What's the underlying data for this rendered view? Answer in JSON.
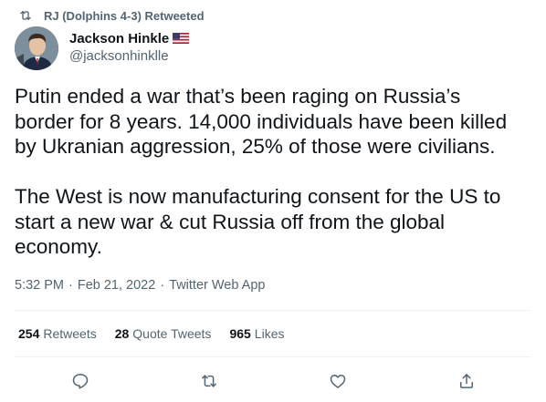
{
  "social_context": {
    "label": "RJ (Dolphins 4-3) Retweeted",
    "icon": "retweet-icon"
  },
  "author": {
    "display_name": "Jackson Hinkle",
    "handle": "@jacksonhinklle",
    "flag": "us-flag-icon"
  },
  "tweet": {
    "paragraphs": [
      "Putin ended a war that’s been raging on Russia’s\nborder for 8 years. 14,000 individuals have been killed\nby Ukranian aggression, 25% of those were civilians.",
      "The West is now manufacturing consent for the US to\nstart a new war & cut Russia off from the global\neconomy."
    ],
    "time": "5:32 PM",
    "date": "Feb 21, 2022",
    "separator": "·",
    "source": "Twitter Web App"
  },
  "stats": {
    "retweets": {
      "count": "254",
      "label": "Retweets"
    },
    "quotes": {
      "count": "28",
      "label": "Quote Tweets"
    },
    "likes": {
      "count": "965",
      "label": "Likes"
    }
  },
  "actions": [
    "reply-icon",
    "retweet-icon",
    "like-icon",
    "share-icon"
  ],
  "colors": {
    "text_primary": "#0f1419",
    "text_secondary": "#536471",
    "divider": "#eff3f4"
  }
}
